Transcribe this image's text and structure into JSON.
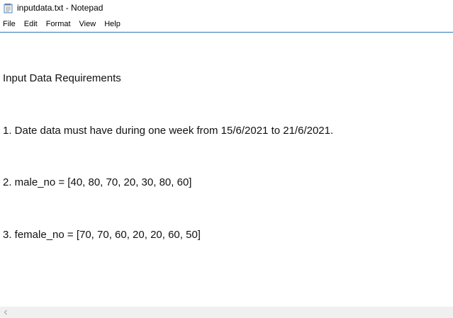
{
  "window": {
    "title": "inputdata.txt - Notepad",
    "icon": "notepad-icon"
  },
  "menu": {
    "items": [
      "File",
      "Edit",
      "Format",
      "View",
      "Help"
    ]
  },
  "editor": {
    "lines": [
      "Input Data Requirements",
      "1. Date data must have during one week from 15/6/2021 to 21/6/2021.",
      "2. male_no = [40, 80, 70, 20, 30, 80, 60]",
      "3. female_no = [70, 70, 60, 20, 20, 60, 50]"
    ]
  },
  "scrollbar": {
    "left_arrow_icon": "chevron-left-icon"
  },
  "colors": {
    "menu_border": "#2f75b5",
    "scrollbar_bg": "#f0f0f0"
  }
}
